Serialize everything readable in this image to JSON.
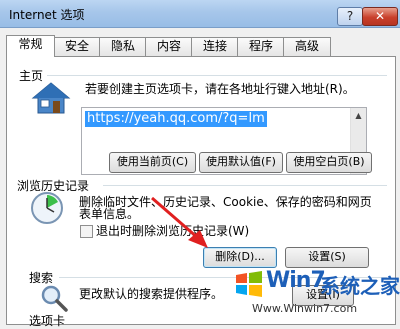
{
  "window": {
    "title": "Internet 选项",
    "help_label": "?",
    "close_label": "✕"
  },
  "tabs": [
    {
      "label": "常规",
      "active": true
    },
    {
      "label": "安全"
    },
    {
      "label": "隐私"
    },
    {
      "label": "内容"
    },
    {
      "label": "连接"
    },
    {
      "label": "程序"
    },
    {
      "label": "高级"
    }
  ],
  "homepage": {
    "section_label": "主页",
    "description": "若要创建主页选项卡，请在各地址行键入地址(R)。",
    "url": "https://yeah.qq.com/?q=lm",
    "buttons": {
      "use_current": "使用当前页(C)",
      "use_default": "使用默认值(F)",
      "use_blank": "使用空白页(B)"
    }
  },
  "history": {
    "section_label": "浏览历史记录",
    "description_line1": "删除临时文件、历史记录、Cookie、保存的密码和网页",
    "description_line2": "表单信息。",
    "checkbox_label": "退出时删除浏览历史记录(W)",
    "buttons": {
      "delete": "删除(D)...",
      "settings": "设置(S)"
    }
  },
  "search": {
    "section_label": "搜索",
    "description": "更改默认的搜索提供程序。",
    "settings_button": "设置(I)"
  },
  "tabs_section": {
    "section_label": "选项卡"
  },
  "icons": {
    "homepage": "house-icon",
    "history": "clock-icon",
    "search": "magnifier-icon",
    "annotation": "red-arrow-icon"
  },
  "watermark": {
    "logo": "Win7",
    "suffix": "系统之家",
    "url": "Www.Winwin7.com"
  },
  "colors": {
    "selection": "#3399ff",
    "annotation": "#e02020",
    "titlebar": "#a6c6ea"
  }
}
